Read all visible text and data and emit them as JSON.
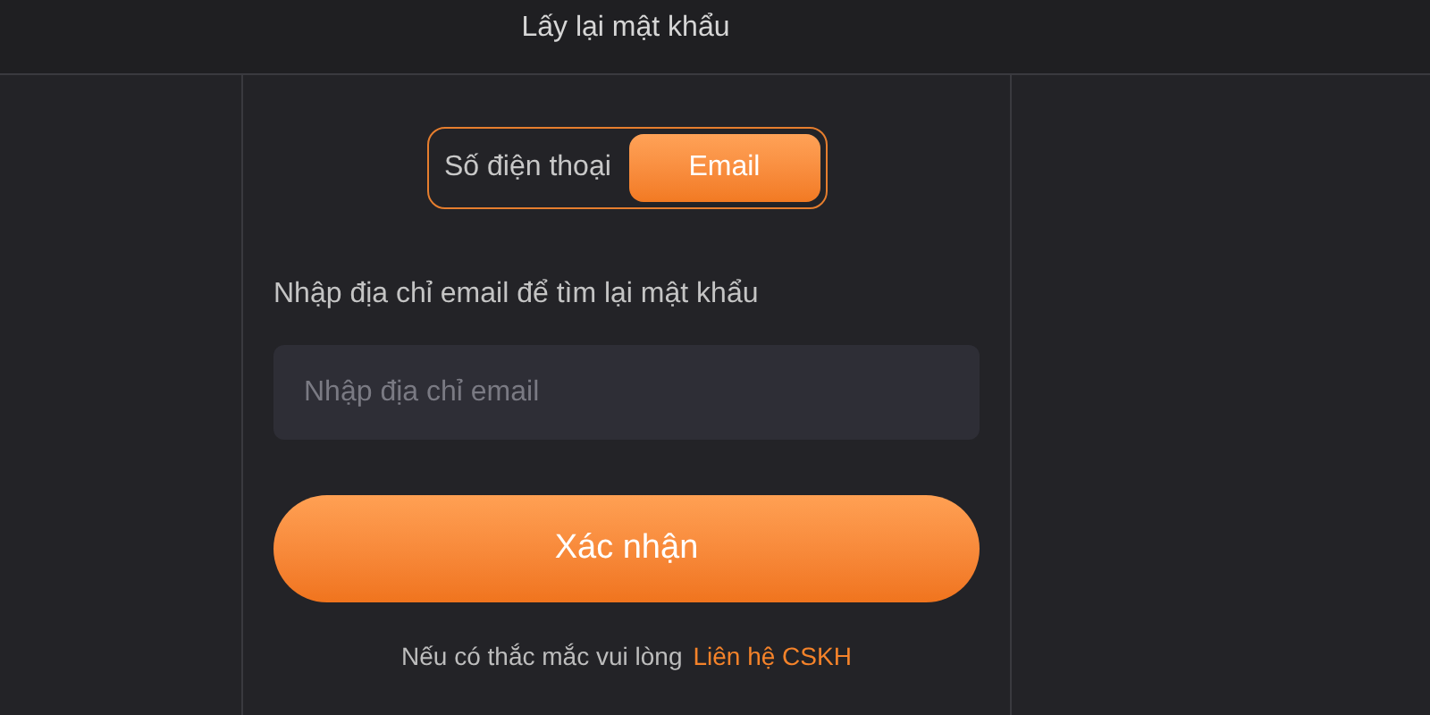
{
  "header": {
    "title": "Lấy lại mật khẩu"
  },
  "tabs": [
    {
      "label": "Số điện thoại",
      "selected": false
    },
    {
      "label": "Email",
      "selected": true
    }
  ],
  "form": {
    "label": "Nhập địa chỉ email để tìm lại mật khẩu",
    "placeholder": "Nhập địa chỉ email",
    "submit": "Xác nhận"
  },
  "footer": {
    "text": "Nếu có thắc mắc vui lòng",
    "link": "Liên hệ CSKH"
  }
}
